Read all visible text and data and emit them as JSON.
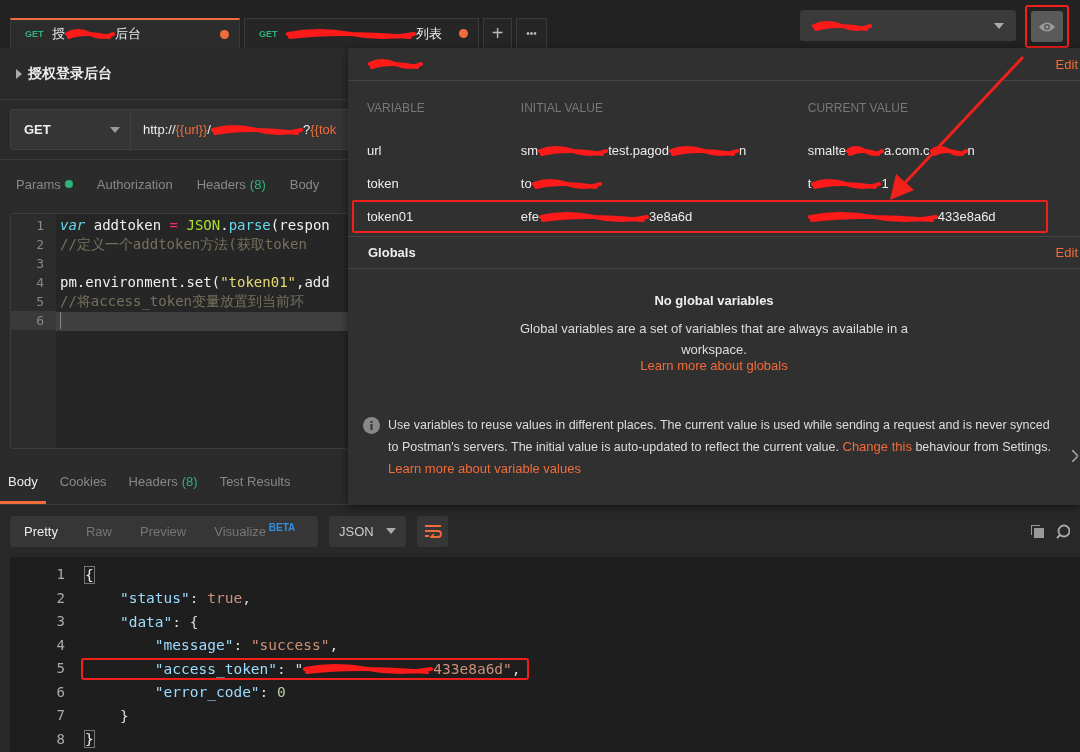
{
  "tabs": [
    {
      "method": "GET",
      "label": [
        {
          "kind": "text",
          "text": "授"
        },
        {
          "kind": "scribble"
        },
        {
          "kind": "text",
          "text": "后台"
        }
      ],
      "selected": true,
      "unsaved": true
    },
    {
      "method": "GET",
      "label": [
        {
          "kind": "scribble"
        },
        {
          "kind": "text",
          "text": "列表"
        }
      ],
      "selected": false,
      "unsaved": true
    }
  ],
  "tab_actions": [
    "+",
    "•••"
  ],
  "environment": {
    "label": [
      {
        "kind": "scribble"
      }
    ]
  },
  "eye_button": {
    "annotated": true
  },
  "request": {
    "title": "授权登录后台",
    "method": "GET",
    "url": [
      {
        "kind": "text",
        "text": "http://"
      },
      {
        "kind": "var",
        "text": "{{url}}"
      },
      {
        "kind": "text",
        "text": "/"
      },
      {
        "kind": "scribble"
      },
      {
        "kind": "text",
        "text": "?"
      },
      {
        "kind": "var",
        "text": "{{tok"
      }
    ]
  },
  "request_tabs": [
    {
      "label": "Params",
      "dot": true
    },
    {
      "label": "Authorization",
      "dot": false
    },
    {
      "label": "Headers",
      "dot": false,
      "count": "(8)"
    },
    {
      "label": "Body",
      "dot": false
    }
  ],
  "script_lines": [
    {
      "number": "1",
      "active": false,
      "segments": [
        {
          "t": "var",
          "kind": "keyword"
        },
        {
          "t": " addtoken ",
          "kind": "plain"
        },
        {
          "t": "=",
          "kind": "op"
        },
        {
          "t": " JSON",
          "kind": "fn"
        },
        {
          "t": ".",
          "kind": "plain"
        },
        {
          "t": "parse",
          "kind": "method"
        },
        {
          "t": "(respon",
          "kind": "plain"
        }
      ]
    },
    {
      "number": "2",
      "active": false,
      "segments": [
        {
          "t": "//定义一个addtoken方法(获取token",
          "kind": "comment"
        }
      ]
    },
    {
      "number": "3",
      "active": false
    },
    {
      "number": "4",
      "active": false,
      "segments": [
        {
          "t": "pm.environment.set(",
          "kind": "plain"
        },
        {
          "t": "\"token01\"",
          "kind": "string"
        },
        {
          "t": ",add",
          "kind": "plain"
        }
      ]
    },
    {
      "number": "5",
      "active": false,
      "segments": [
        {
          "t": "//将access_token变量放置到当前环",
          "kind": "comment"
        }
      ]
    },
    {
      "number": "6",
      "active": true
    }
  ],
  "response_tabs": [
    {
      "label": "Body",
      "selected": true
    },
    {
      "label": "Cookies",
      "selected": false
    },
    {
      "label": "Headers",
      "count": "(8)",
      "selected": false
    },
    {
      "label": "Test Results",
      "selected": false
    }
  ],
  "view_modes": [
    {
      "label": "Pretty",
      "selected": true
    },
    {
      "label": "Raw",
      "selected": false
    },
    {
      "label": "Preview",
      "selected": false
    },
    {
      "label": "Visualize",
      "badge": "BETA",
      "selected": false
    }
  ],
  "format": "JSON",
  "response_lines": [
    {
      "number": "1",
      "annotated": false,
      "segments": [
        {
          "t": "{",
          "kind": "brace"
        }
      ]
    },
    {
      "number": "2",
      "annotated": false,
      "segments": [
        {
          "t": "    \"status\"",
          "kind": "key"
        },
        {
          "t": ": ",
          "kind": "punct"
        },
        {
          "t": "true",
          "kind": "value"
        },
        {
          "t": ",",
          "kind": "punct"
        }
      ]
    },
    {
      "number": "3",
      "annotated": false,
      "segments": [
        {
          "t": "    \"data\"",
          "kind": "key"
        },
        {
          "t": ": {",
          "kind": "punct"
        }
      ]
    },
    {
      "number": "4",
      "annotated": false,
      "segments": [
        {
          "t": "        \"message\"",
          "kind": "key"
        },
        {
          "t": ": ",
          "kind": "punct"
        },
        {
          "t": "\"success\"",
          "kind": "value"
        },
        {
          "t": ",",
          "kind": "punct"
        }
      ]
    },
    {
      "number": "5",
      "annotated": true,
      "segments": [
        {
          "t": "        \"access_token\"",
          "kind": "key"
        },
        {
          "t": ": \"",
          "kind": "punct"
        },
        {
          "kind": "scribble"
        },
        {
          "t": "433e8a6d\"",
          "kind": "value"
        },
        {
          "t": ",",
          "kind": "punct"
        }
      ]
    },
    {
      "number": "6",
      "annotated": false,
      "segments": [
        {
          "t": "        \"error_code\"",
          "kind": "key"
        },
        {
          "t": ": ",
          "kind": "punct"
        },
        {
          "t": "0",
          "kind": "number"
        }
      ]
    },
    {
      "number": "7",
      "annotated": false,
      "segments": [
        {
          "t": "    }",
          "kind": "punct"
        }
      ]
    },
    {
      "number": "8",
      "annotated": false,
      "segments": [
        {
          "t": "}",
          "kind": "brace"
        }
      ]
    }
  ],
  "env_panel": {
    "title": [
      {
        "kind": "scribble"
      }
    ],
    "edit": "Edit",
    "columns": [
      "VARIABLE",
      "INITIAL VALUE",
      "CURRENT VALUE"
    ],
    "variables": [
      {
        "name": "url",
        "annotated": false,
        "initial": [
          {
            "kind": "text",
            "text": "sm"
          },
          {
            "kind": "scribble"
          },
          {
            "kind": "text",
            "text": "test.pagod"
          },
          {
            "kind": "scribble"
          },
          {
            "kind": "text",
            "text": "n"
          }
        ],
        "current": [
          {
            "kind": "text",
            "text": "smalte"
          },
          {
            "kind": "scribble"
          },
          {
            "kind": "text",
            "text": "a.com.c"
          },
          {
            "kind": "scribble"
          },
          {
            "kind": "text",
            "text": "n"
          }
        ]
      },
      {
        "name": "token",
        "annotated": false,
        "initial": [
          {
            "kind": "text",
            "text": "to"
          },
          {
            "kind": "scribble"
          }
        ],
        "current": [
          {
            "kind": "text",
            "text": "t"
          },
          {
            "kind": "scribble"
          },
          {
            "kind": "text",
            "text": "1"
          }
        ]
      },
      {
        "name": "token01",
        "annotated": true,
        "initial": [
          {
            "kind": "text",
            "text": "efe"
          },
          {
            "kind": "scribble"
          },
          {
            "kind": "text",
            "text": "3e8a6d"
          }
        ],
        "current": [
          {
            "kind": "scribble"
          },
          {
            "kind": "text",
            "text": "433e8a6d"
          }
        ]
      }
    ]
  },
  "globals": {
    "title": "Globals",
    "edit": "Edit",
    "empty_title": "No global variables",
    "empty_text": "Global variables are a set of variables that are always available in a workspace.",
    "link": "Learn more about globals"
  },
  "info": {
    "text_before": "Use variables to reuse values in different places. The current value is used while sending a request and is never synced to Postman's servers. The initial value is auto-updated to reflect the current value.",
    "link1": "Change this",
    "text_middle": "behaviour from Settings.",
    "link2": "Learn more about variable values"
  }
}
